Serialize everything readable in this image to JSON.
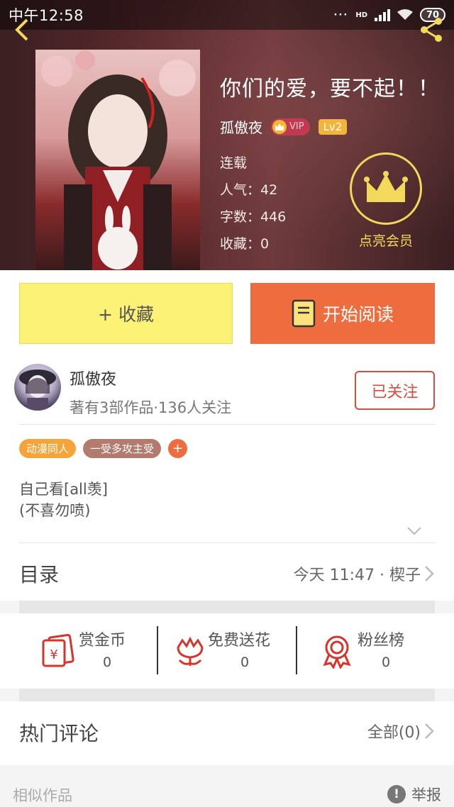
{
  "status_bar": {
    "time": "中午12:58",
    "network": "HD",
    "battery": "70"
  },
  "book": {
    "title": "你们的爱，要不起！！",
    "author": "孤傲夜",
    "vip_label": "VIP",
    "level": "Lv2",
    "status": "连载",
    "popularity": "人气：42",
    "word_count": "字数：446",
    "favorites": "收藏：0"
  },
  "vip_member": {
    "label": "点亮会员"
  },
  "actions": {
    "collect_label": "+ 收藏",
    "read_label": "开始阅读"
  },
  "author_card": {
    "name": "孤傲夜",
    "stats": "著有3部作品·136人关注",
    "follow_label": "已关注"
  },
  "tags": [
    "动漫同人",
    "一受多攻主受"
  ],
  "tag_add": "+",
  "description": {
    "line1": "自己看[all羡]",
    "line2": "(不喜勿喷)"
  },
  "catalog": {
    "title": "目录",
    "latest": "今天 11:47 · 楔子"
  },
  "rewards": [
    {
      "label": "赏金币",
      "value": "0",
      "icon": "red-envelope-icon"
    },
    {
      "label": "免费送花",
      "value": "0",
      "icon": "flower-icon"
    },
    {
      "label": "粉丝榜",
      "value": "0",
      "icon": "medal-icon"
    }
  ],
  "comments": {
    "title": "热门评论",
    "all": "全部(0)"
  },
  "footer": {
    "similar": "相似作品",
    "report": "举报",
    "report_icon_glyph": "!"
  },
  "colors": {
    "accent_orange": "#ef6c3e",
    "collect_yellow": "#fbf174",
    "vip_gold": "#f2d85b",
    "follow_red": "#d94a3f",
    "icon_red": "#d9332b"
  }
}
